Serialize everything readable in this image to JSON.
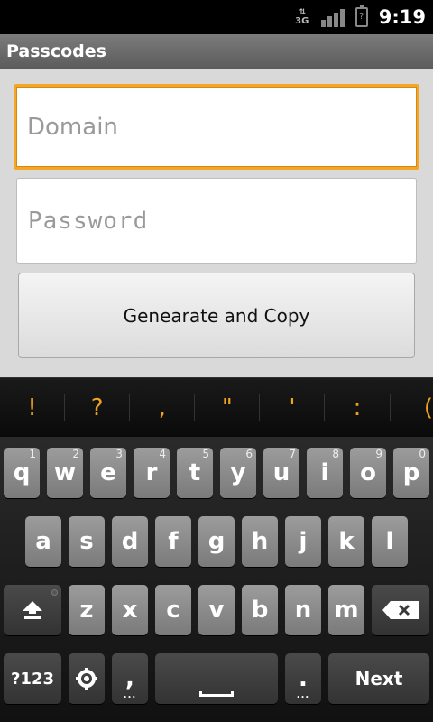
{
  "status": {
    "network": "3G",
    "battery": "?",
    "time": "9:19"
  },
  "titlebar": {
    "title": "Passcodes"
  },
  "form": {
    "domain_placeholder": "Domain",
    "domain_value": "",
    "password_placeholder": "Password",
    "password_value": "",
    "button_label": "Genearate and Copy"
  },
  "keyboard": {
    "suggestions": [
      "!",
      "?",
      ",",
      "\"",
      "'",
      ":",
      "("
    ],
    "row1": [
      {
        "k": "q",
        "n": "1"
      },
      {
        "k": "w",
        "n": "2"
      },
      {
        "k": "e",
        "n": "3"
      },
      {
        "k": "r",
        "n": "4"
      },
      {
        "k": "t",
        "n": "5"
      },
      {
        "k": "y",
        "n": "6"
      },
      {
        "k": "u",
        "n": "7"
      },
      {
        "k": "i",
        "n": "8"
      },
      {
        "k": "o",
        "n": "9"
      },
      {
        "k": "p",
        "n": "0"
      }
    ],
    "row2": [
      "a",
      "s",
      "d",
      "f",
      "g",
      "h",
      "j",
      "k",
      "l"
    ],
    "row3": [
      "z",
      "x",
      "c",
      "v",
      "b",
      "n",
      "m"
    ],
    "symbols_label": "?123",
    "comma": ",",
    "period": ".",
    "next_label": "Next"
  },
  "accent_color": "#f5a623"
}
